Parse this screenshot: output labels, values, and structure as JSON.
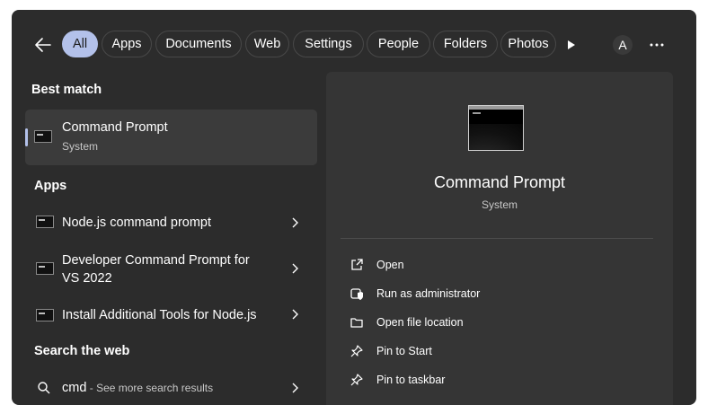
{
  "filters": {
    "tabs": [
      "All",
      "Apps",
      "Documents",
      "Web",
      "Settings",
      "People",
      "Folders",
      "Photos"
    ],
    "avatar_initial": "A"
  },
  "results": {
    "best_match_heading": "Best match",
    "best_match": {
      "title": "Command Prompt",
      "subtitle": "System"
    },
    "apps_heading": "Apps",
    "apps": [
      {
        "title": "Node.js command prompt"
      },
      {
        "title": "Developer Command Prompt for",
        "title_line2": "VS 2022"
      },
      {
        "title": "Install Additional Tools for Node.js"
      }
    ],
    "web_heading": "Search the web",
    "web_query": "cmd",
    "web_suffix": " - See more search results"
  },
  "detail": {
    "title": "Command Prompt",
    "subtitle": "System",
    "actions": [
      {
        "label": "Open",
        "icon": "open-external-icon"
      },
      {
        "label": "Run as administrator",
        "icon": "shield-icon"
      },
      {
        "label": "Open file location",
        "icon": "folder-icon"
      },
      {
        "label": "Pin to Start",
        "icon": "pin-icon"
      },
      {
        "label": "Pin to taskbar",
        "icon": "pin-icon"
      }
    ]
  },
  "colors": {
    "panel": "#2c2c2c",
    "detail": "#353535",
    "accent": "#b3c1ea"
  }
}
